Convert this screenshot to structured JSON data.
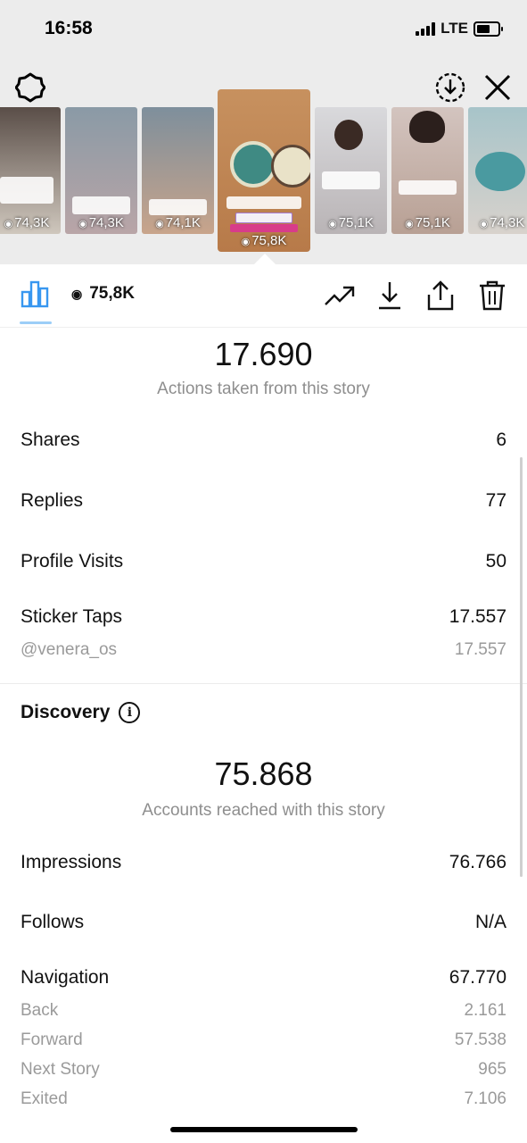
{
  "status_bar": {
    "time": "16:58",
    "network": "LTE"
  },
  "stories": [
    {
      "views": "74,3K",
      "colors": [
        "#5a4e48",
        "#cfc7bd"
      ]
    },
    {
      "views": "74,3K",
      "colors": [
        "#8a9aa6",
        "#b9a5a7"
      ]
    },
    {
      "views": "74,1K",
      "colors": [
        "#7e8f9c",
        "#c8a48b"
      ]
    },
    {
      "views": "75,8K",
      "colors": [
        "#c7915f",
        "#b77a49"
      ]
    },
    {
      "views": "75,1K",
      "colors": [
        "#d9d9dc",
        "#b9b4b6"
      ]
    },
    {
      "views": "75,1K",
      "colors": [
        "#d3c4bf",
        "#b8a094"
      ]
    },
    {
      "views": "74,3K",
      "colors": [
        "#a7c4c9",
        "#d8d2cc"
      ]
    }
  ],
  "toolbar": {
    "views": "75,8K"
  },
  "interactions": {
    "total": "17.690",
    "caption": "Actions taken from this story",
    "rows": [
      {
        "label": "Shares",
        "value": "6"
      },
      {
        "label": "Replies",
        "value": "77"
      },
      {
        "label": "Profile Visits",
        "value": "50"
      },
      {
        "label": "Sticker Taps",
        "value": "17.557"
      }
    ],
    "sticker_sub": {
      "label": "@venera_os",
      "value": "17.557"
    }
  },
  "discovery": {
    "title": "Discovery",
    "total": "75.868",
    "caption": "Accounts reached with this story",
    "rows": [
      {
        "label": "Impressions",
        "value": "76.766"
      },
      {
        "label": "Follows",
        "value": "N/A"
      },
      {
        "label": "Navigation",
        "value": "67.770"
      }
    ],
    "navigation_sub": [
      {
        "label": "Back",
        "value": "2.161"
      },
      {
        "label": "Forward",
        "value": "57.538"
      },
      {
        "label": "Next Story",
        "value": "965"
      },
      {
        "label": "Exited",
        "value": "7.106"
      }
    ]
  }
}
